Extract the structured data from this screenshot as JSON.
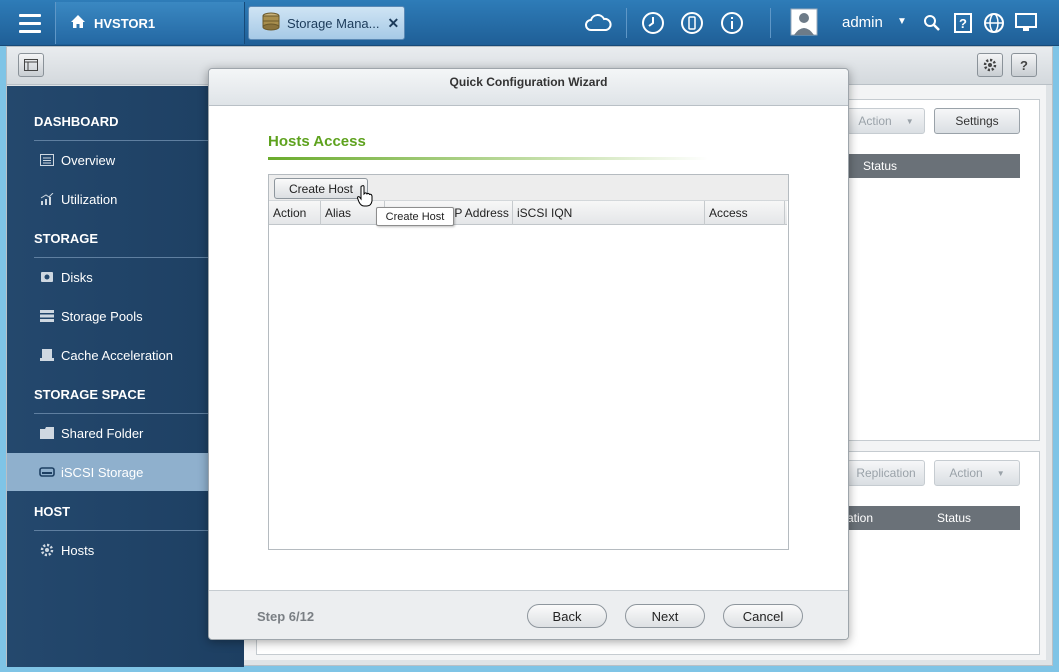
{
  "topbar": {
    "home_label": "HVSTOR1",
    "tab_label": "Storage Mana...",
    "tab_close": "✕",
    "user_name": "admin",
    "user_caret": "▼",
    "icons": [
      "menu-icon",
      "home-icon",
      "storage-app-icon",
      "close-icon",
      "cloud-icon",
      "clock-icon",
      "sync-icon",
      "info-icon",
      "user-avatar-icon",
      "search-icon",
      "help-icon",
      "globe-icon",
      "monitor-icon"
    ]
  },
  "toolbar": {
    "help_label": "?"
  },
  "sidebar": {
    "sections": [
      {
        "title": "DASHBOARD",
        "items": [
          {
            "label": "Overview",
            "icon": "overview-icon"
          },
          {
            "label": "Utilization",
            "icon": "utilization-icon"
          }
        ]
      },
      {
        "title": "STORAGE",
        "items": [
          {
            "label": "Disks",
            "icon": "disk-icon"
          },
          {
            "label": "Storage Pools",
            "icon": "storage-pools-icon"
          },
          {
            "label": "Cache Acceleration",
            "icon": "cache-icon"
          }
        ]
      },
      {
        "title": "STORAGE SPACE",
        "items": [
          {
            "label": "Shared Folder",
            "icon": "folder-icon"
          },
          {
            "label": "iSCSI Storage",
            "icon": "iscsi-icon",
            "active": true
          }
        ]
      },
      {
        "title": "HOST",
        "items": [
          {
            "label": "Hosts",
            "icon": "gear-icon"
          }
        ]
      }
    ]
  },
  "background": {
    "action_label": "Action",
    "settings_label": "Settings",
    "status_header": "Status",
    "replication_label": "Replication",
    "action2_label": "Action",
    "ation_header": "ation",
    "status2_header": "Status"
  },
  "wizard": {
    "title": "Quick Configuration Wizard",
    "section_title": "Hosts Access",
    "create_host_label": "Create Host",
    "tooltip": "Create Host",
    "columns": [
      "Action",
      "Alias",
      "IP Address",
      "iSCSI IQN",
      "Access"
    ],
    "rows": [],
    "step_label": "Step 6/12",
    "back_label": "Back",
    "next_label": "Next",
    "cancel_label": "Cancel"
  },
  "colors": {
    "accent_green": "#5ea21e",
    "topbar_blue": "#2468a3",
    "sidebar_blue": "#1d3f62",
    "active_item": "#8fb0cd"
  }
}
